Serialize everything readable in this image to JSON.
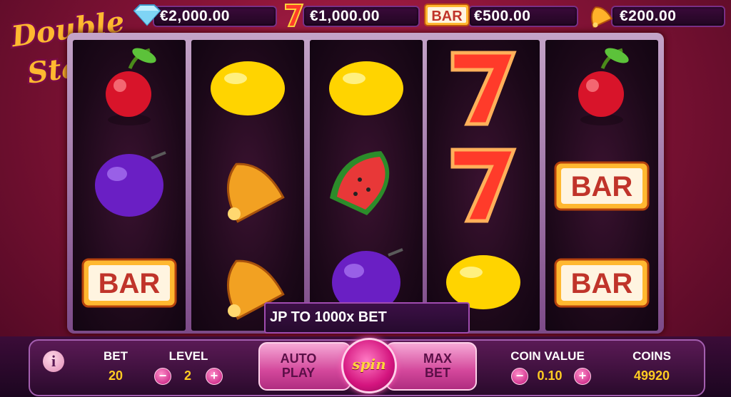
{
  "game": {
    "logo_line1": "Double",
    "logo_line2": "Stacks"
  },
  "jackpots": [
    {
      "icon": "diamond-icon",
      "value": "€2,000.00"
    },
    {
      "icon": "seven-icon",
      "value": "€1,000.00"
    },
    {
      "icon": "bar-icon",
      "icon_text": "BAR",
      "value": "€500.00"
    },
    {
      "icon": "bell-icon",
      "value": "€200.00"
    }
  ],
  "reels": [
    [
      "cherry",
      "plum",
      "bar"
    ],
    [
      "lemon",
      "bell",
      "bell"
    ],
    [
      "lemon",
      "watermelon",
      "plum"
    ],
    [
      "seven",
      "seven",
      "lemon"
    ],
    [
      "cherry",
      "bar",
      "bar"
    ]
  ],
  "bar_symbol_text": "BAR",
  "ticker": "JP TO 1000x BET",
  "controls": {
    "info_label": "i",
    "bet_label": "BET",
    "bet_value": "20",
    "level_label": "LEVEL",
    "level_value": "2",
    "minus": "−",
    "plus": "+",
    "auto_play": "AUTO PLAY",
    "auto_line1": "AUTO",
    "auto_line2": "PLAY",
    "spin_label": "spin",
    "max_line1": "MAX",
    "max_line2": "BET",
    "coin_value_label": "COIN VALUE",
    "coin_value": "0.10",
    "coins_label": "COINS",
    "coins_value": "49920"
  },
  "colors": {
    "accent": "#d4147e",
    "gold": "#ffcc22",
    "panel": "#3b0c38"
  }
}
